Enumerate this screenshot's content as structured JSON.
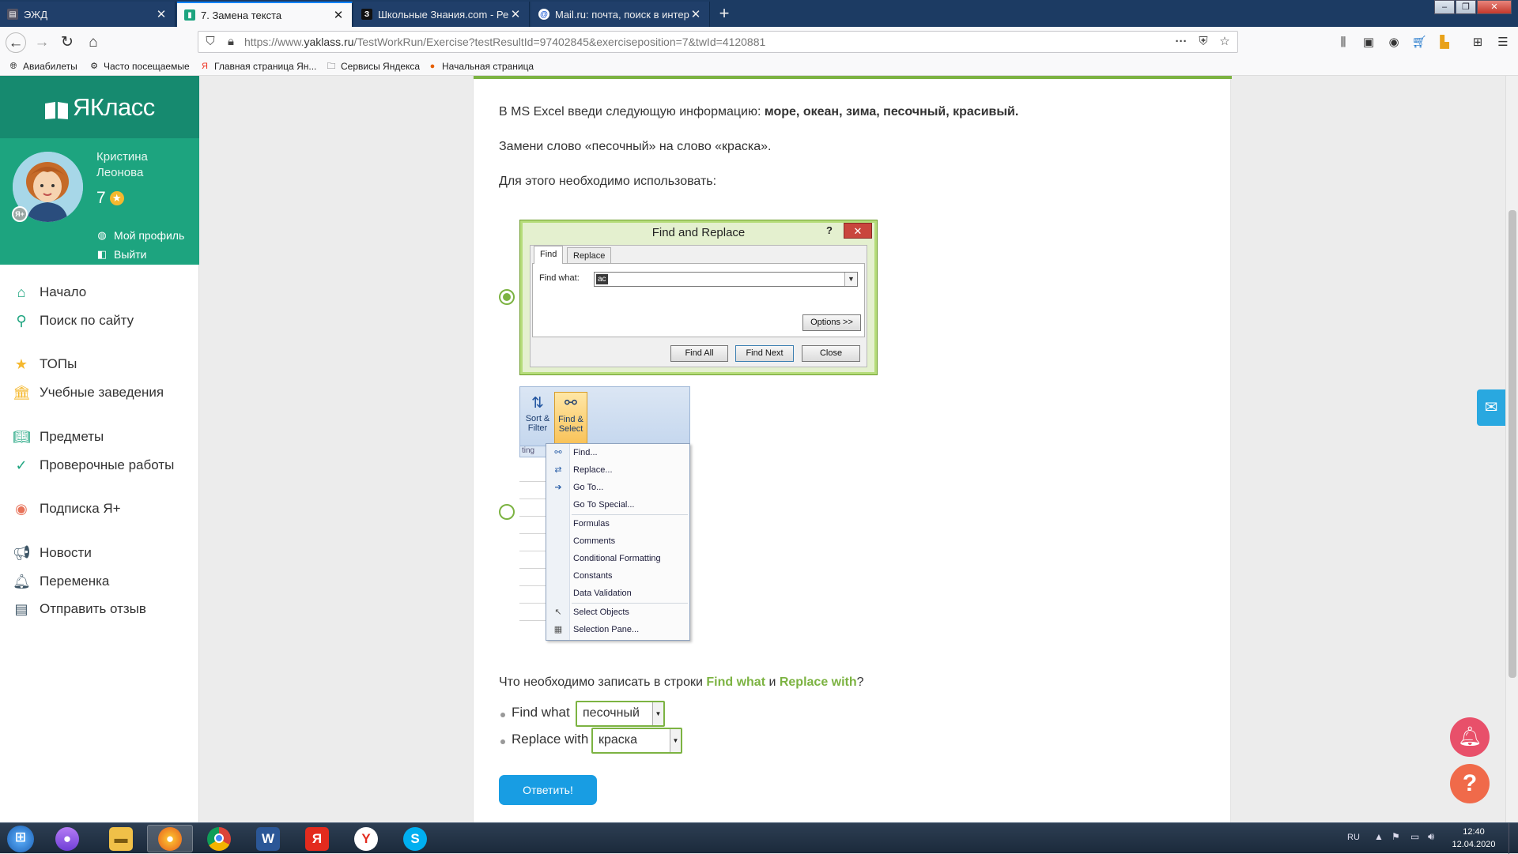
{
  "browser": {
    "tabs": [
      {
        "title": "ЭЖД",
        "active": false
      },
      {
        "title": "7. Замена текста",
        "active": true
      },
      {
        "title": "Школьные Знания.com - Реш",
        "active": false
      },
      {
        "title": "Mail.ru: почта, поиск в интерн",
        "active": false
      }
    ],
    "url_prefix": "https://www.",
    "url_host": "yaklass.ru",
    "url_path": "/TestWorkRun/Exercise?testResultId=97402845&exerciseposition=7&twId=4120881",
    "bookmarks": [
      "Авиабилеты",
      "Часто посещаемые",
      "Главная страница Ян...",
      "Сервисы Яндекса",
      "Начальная страница"
    ]
  },
  "sidebar": {
    "logo": "ЯКласс",
    "user_first": "Кристина",
    "user_last": "Леонова",
    "points": "7",
    "avatar_badge": "Я+",
    "profile_link": "Мой профиль",
    "logout_link": "Выйти",
    "menu": [
      {
        "label": "Начало",
        "icon": "home-icon"
      },
      {
        "label": "Поиск по сайту",
        "icon": "search-icon"
      },
      {
        "label": "ТОПы",
        "icon": "star-icon"
      },
      {
        "label": "Учебные заведения",
        "icon": "institution-icon"
      },
      {
        "label": "Предметы",
        "icon": "book-icon"
      },
      {
        "label": "Проверочные работы",
        "icon": "check-icon"
      },
      {
        "label": "Подписка Я+",
        "icon": "subscription-icon"
      },
      {
        "label": "Новости",
        "icon": "megaphone-icon"
      },
      {
        "label": "Переменка",
        "icon": "bell-icon"
      },
      {
        "label": "Отправить отзыв",
        "icon": "feedback-icon"
      }
    ]
  },
  "task": {
    "line1_prefix": "В MS Excel введи следующую информацию: ",
    "line1_bold": "море, океан, зима, песочный, красивый.",
    "line2": "Замени слово «песочный» на слово «краска».",
    "line3": "Для этого необходимо использовать:",
    "question_prefix": "Что необходимо записать в строки ",
    "question_find": "Find what",
    "question_and": " и ",
    "question_replace": "Replace with",
    "question_suffix": "?",
    "find_label": "Find what",
    "find_value": "песочный",
    "replace_label": "Replace with",
    "replace_value": "краска",
    "submit": "Ответить!"
  },
  "option1_dialog": {
    "selected": true,
    "title": "Find and Replace",
    "help": "?",
    "tab_find": "Find",
    "tab_replace": "Replace",
    "find_what_label": "Find what:",
    "find_what_value": "ac",
    "options_btn": "Options >>",
    "find_all_btn": "Find All",
    "find_next_btn": "Find Next",
    "close_btn": "Close"
  },
  "option2_menu": {
    "selected": false,
    "sort_filter": "Sort & Filter",
    "find_select": "Find & Select",
    "ribbon_fragment": "ting",
    "items": [
      {
        "label": "Find...",
        "icon": "binoculars-icon"
      },
      {
        "label": "Replace...",
        "icon": "replace-icon"
      },
      {
        "label": "Go To...",
        "icon": "arrow-right-icon"
      },
      {
        "label": "Go To Special...",
        "icon": ""
      },
      {
        "label": "Formulas",
        "icon": ""
      },
      {
        "label": "Comments",
        "icon": ""
      },
      {
        "label": "Conditional Formatting",
        "icon": ""
      },
      {
        "label": "Constants",
        "icon": ""
      },
      {
        "label": "Data Validation",
        "icon": ""
      },
      {
        "label": "Select Objects",
        "icon": "cursor-icon"
      },
      {
        "label": "Selection Pane...",
        "icon": "selection-pane-icon"
      }
    ]
  },
  "taskbar": {
    "lang": "RU",
    "time": "12:40",
    "date": "12.04.2020"
  },
  "colors": {
    "brand_dark": "#168a6f",
    "brand": "#1da47f",
    "accent_green": "#7cb342",
    "button_blue": "#189de3"
  }
}
